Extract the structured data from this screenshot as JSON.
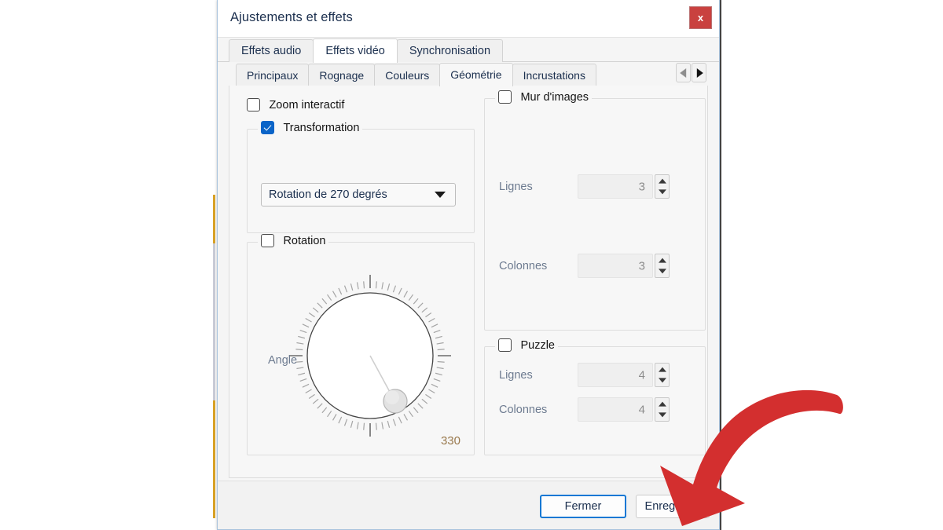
{
  "window": {
    "title": "Ajustements et effets",
    "close_label": "x",
    "close_icon": "close-icon",
    "close_color": "#c9413f"
  },
  "outer_tabs": [
    {
      "label": "Effets audio",
      "selected": false
    },
    {
      "label": "Effets vidéo",
      "selected": true
    },
    {
      "label": "Synchronisation",
      "selected": false
    }
  ],
  "inner_tabs": [
    {
      "label": "Principaux",
      "selected": false
    },
    {
      "label": "Rognage",
      "selected": false
    },
    {
      "label": "Couleurs",
      "selected": false
    },
    {
      "label": "Géométrie",
      "selected": true
    },
    {
      "label": "Incrustations",
      "selected": false
    }
  ],
  "tab_scroll": {
    "prev_icon": "chevron-left-icon",
    "next_icon": "chevron-right-icon"
  },
  "left_column": {
    "interactive_zoom": {
      "label": "Zoom interactif",
      "checked": false
    },
    "transformation": {
      "label": "Transformation",
      "checked": true,
      "select_value": "Rotation de 270 degrés",
      "select_icon": "chevron-down-icon"
    },
    "rotation": {
      "label": "Rotation",
      "checked": false,
      "angle_label": "Angle",
      "angle_value": "330"
    }
  },
  "right_column": {
    "image_wall": {
      "label": "Mur d'images",
      "checked": false,
      "rows_label": "Lignes",
      "rows_value": "3",
      "cols_label": "Colonnes",
      "cols_value": "3"
    },
    "puzzle": {
      "label": "Puzzle",
      "checked": false,
      "rows_label": "Lignes",
      "rows_value": "4",
      "cols_label": "Colonnes",
      "cols_value": "4"
    }
  },
  "footer": {
    "close_button": "Fermer",
    "save_button": "Enregistrer"
  },
  "annotation": {
    "arrow_icon": "curved-arrow-annotation",
    "arrow_color": "#d32f2f",
    "points_at": "Enregistrer"
  }
}
